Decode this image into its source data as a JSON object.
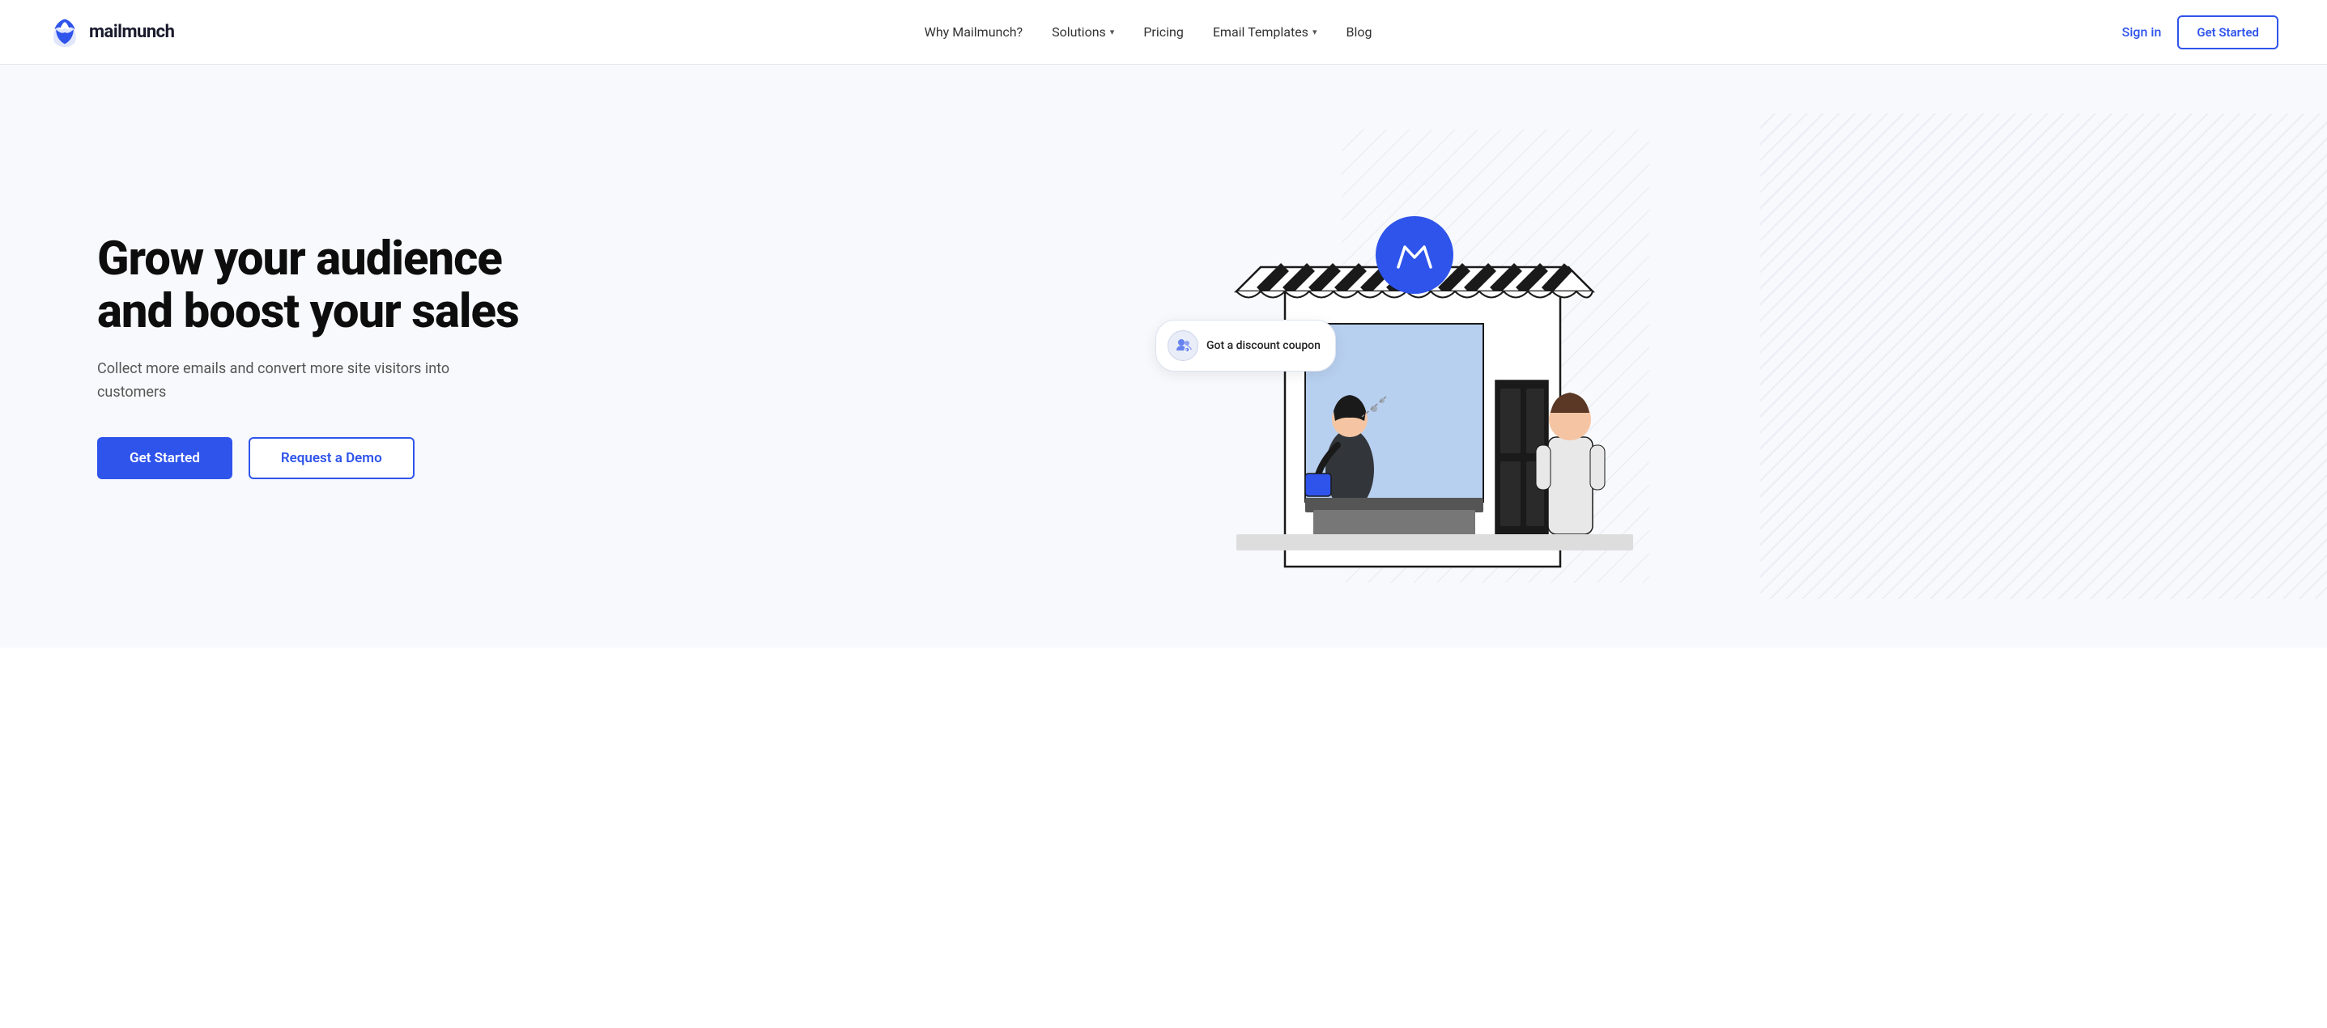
{
  "logo": {
    "text": "mailmunch",
    "icon_label": "mailmunch-logo-icon"
  },
  "navbar": {
    "links": [
      {
        "label": "Why Mailmunch?",
        "has_dropdown": false
      },
      {
        "label": "Solutions",
        "has_dropdown": true
      },
      {
        "label": "Pricing",
        "has_dropdown": false
      },
      {
        "label": "Email Templates",
        "has_dropdown": true
      },
      {
        "label": "Blog",
        "has_dropdown": false
      }
    ],
    "sign_in_label": "Sign in",
    "get_started_label": "Get Started"
  },
  "hero": {
    "title": "Grow your audience and boost your sales",
    "subtitle": "Collect more emails and convert more site visitors into customers",
    "cta_primary": "Get Started",
    "cta_secondary": "Request a Demo",
    "discount_bubble_text": "Got a discount coupon"
  }
}
